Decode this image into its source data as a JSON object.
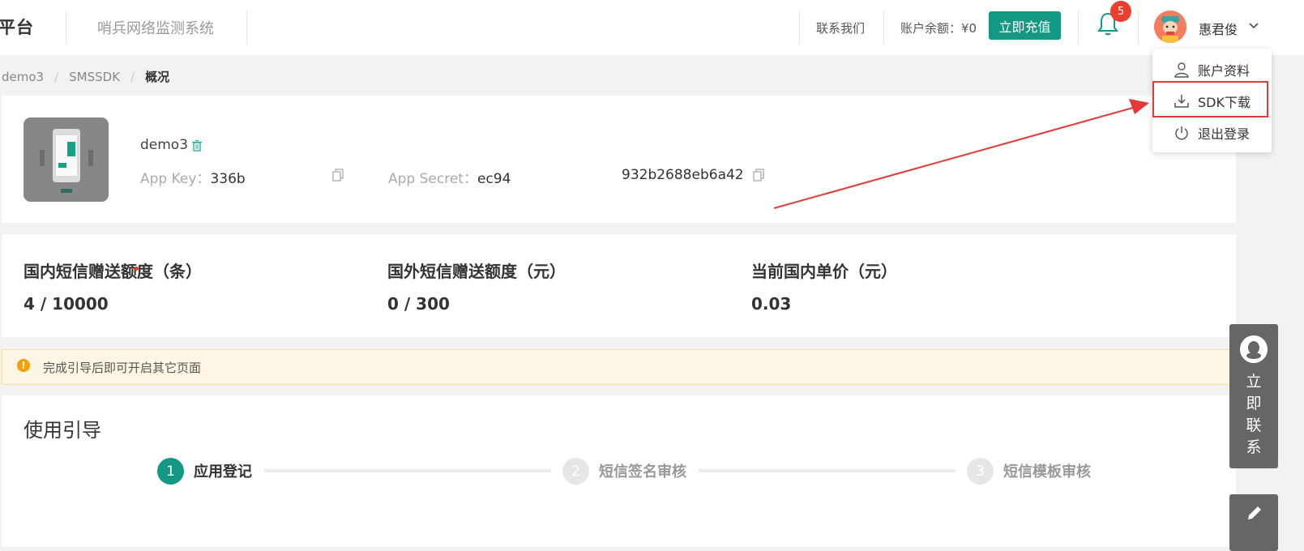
{
  "header": {
    "brand": "平台",
    "system_name": "哨兵网络监测系统",
    "contact": "联系我们",
    "balance": "账户余额：¥0",
    "recharge": "立即充值",
    "notification_count": "5",
    "username": "惠君俊"
  },
  "breadcrumb": [
    "demo3",
    "SMSSDK",
    "概况"
  ],
  "app": {
    "name": "demo3",
    "app_key_label": "App Key：",
    "app_key_value": "336b",
    "app_secret_label": "App Secret：",
    "app_secret_value": "ec94",
    "app_secret_tail": "932b2688eb6a42"
  },
  "stats": [
    {
      "title": "国内短信赠送额度（条）",
      "value": "4 / 10000"
    },
    {
      "title": "国外短信赠送额度（元）",
      "value": "0 / 300"
    },
    {
      "title": "当前国内单价（元）",
      "value": "0.03"
    }
  ],
  "notice": "完成引导后即可开启其它页面",
  "guide": {
    "title": "使用引导",
    "steps": [
      {
        "num": "1",
        "label": "应用登记",
        "active": true
      },
      {
        "num": "2",
        "label": "短信签名审核",
        "active": false
      },
      {
        "num": "3",
        "label": "短信模板审核",
        "active": false
      }
    ]
  },
  "dropdown": {
    "items": [
      "账户资料",
      "SDK下载",
      "退出登录"
    ]
  },
  "float": {
    "contact_now": "立即联系"
  },
  "colors": {
    "primary": "#129883",
    "badge": "#ea3f2e",
    "highlight": "#e53935"
  }
}
